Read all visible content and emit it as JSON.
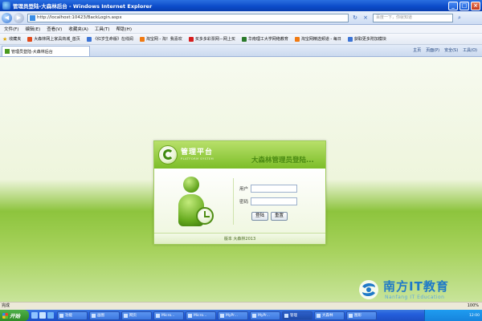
{
  "window": {
    "title": "管理员登陆-大森林后台 - Windows Internet Explorer",
    "minimize": "_",
    "maximize": "□",
    "close": "×"
  },
  "address_bar": {
    "url": "http://localhost:10423/BackLogin.aspx",
    "search_placeholder": "百度一下，你就知道",
    "back": "◀",
    "forward": "▶",
    "refresh": "↻",
    "stop": "×"
  },
  "menu": [
    "文件(F)",
    "编辑(E)",
    "查看(V)",
    "收藏夹(A)",
    "工具(T)",
    "帮助(H)"
  ],
  "favorites": {
    "label": "收藏夹",
    "items": [
      {
        "label": "大森林网上家具商城_首页",
        "color": "#e24a1a"
      },
      {
        "label": "《红岁生命版》在线阅",
        "color": "#3c74d6"
      },
      {
        "label": "淘宝网 - 淘！我喜欢",
        "color": "#f07a12"
      },
      {
        "label": "买多多彩票网－网上买",
        "color": "#d61e1e"
      },
      {
        "label": "华南理工大学网络教育",
        "color": "#2b7a2b"
      },
      {
        "label": "淘宝网精选频道 - 每日",
        "color": "#f07a12"
      },
      {
        "label": "获取更多附加模块",
        "color": "#3c74d6"
      }
    ]
  },
  "tab": {
    "label": "管理员登陆-大森林后台"
  },
  "command_bar": [
    "主页",
    "页面(P)",
    "安全(S)",
    "工具(O)"
  ],
  "login_panel": {
    "brand_title": "管理平台",
    "brand_subtitle": "PLATFORM SYSTEM",
    "heading": "大森林管理员登陆...",
    "username_label": "用户",
    "password_label": "密码",
    "username_value": "",
    "password_value": "",
    "login_button": "登陆",
    "reset_button": "重置",
    "footer": "版本 大森林2013"
  },
  "status_bar": {
    "status": "完成",
    "zone": "Internet",
    "zoom": "100%"
  },
  "taskbar": {
    "start": "开始",
    "tasks": [
      {
        "label": "功能"
      },
      {
        "label": "画图"
      },
      {
        "label": "网页"
      },
      {
        "label": "Micro..."
      },
      {
        "label": "Micro..."
      },
      {
        "label": "MyPr..."
      },
      {
        "label": "MyPr..."
      },
      {
        "label": "管理"
      },
      {
        "label": "大森林"
      },
      {
        "label": "图形"
      }
    ],
    "clock": "12:00"
  },
  "watermark": {
    "name": "南方IT教育",
    "subtitle": "Nanfang IT Education"
  }
}
